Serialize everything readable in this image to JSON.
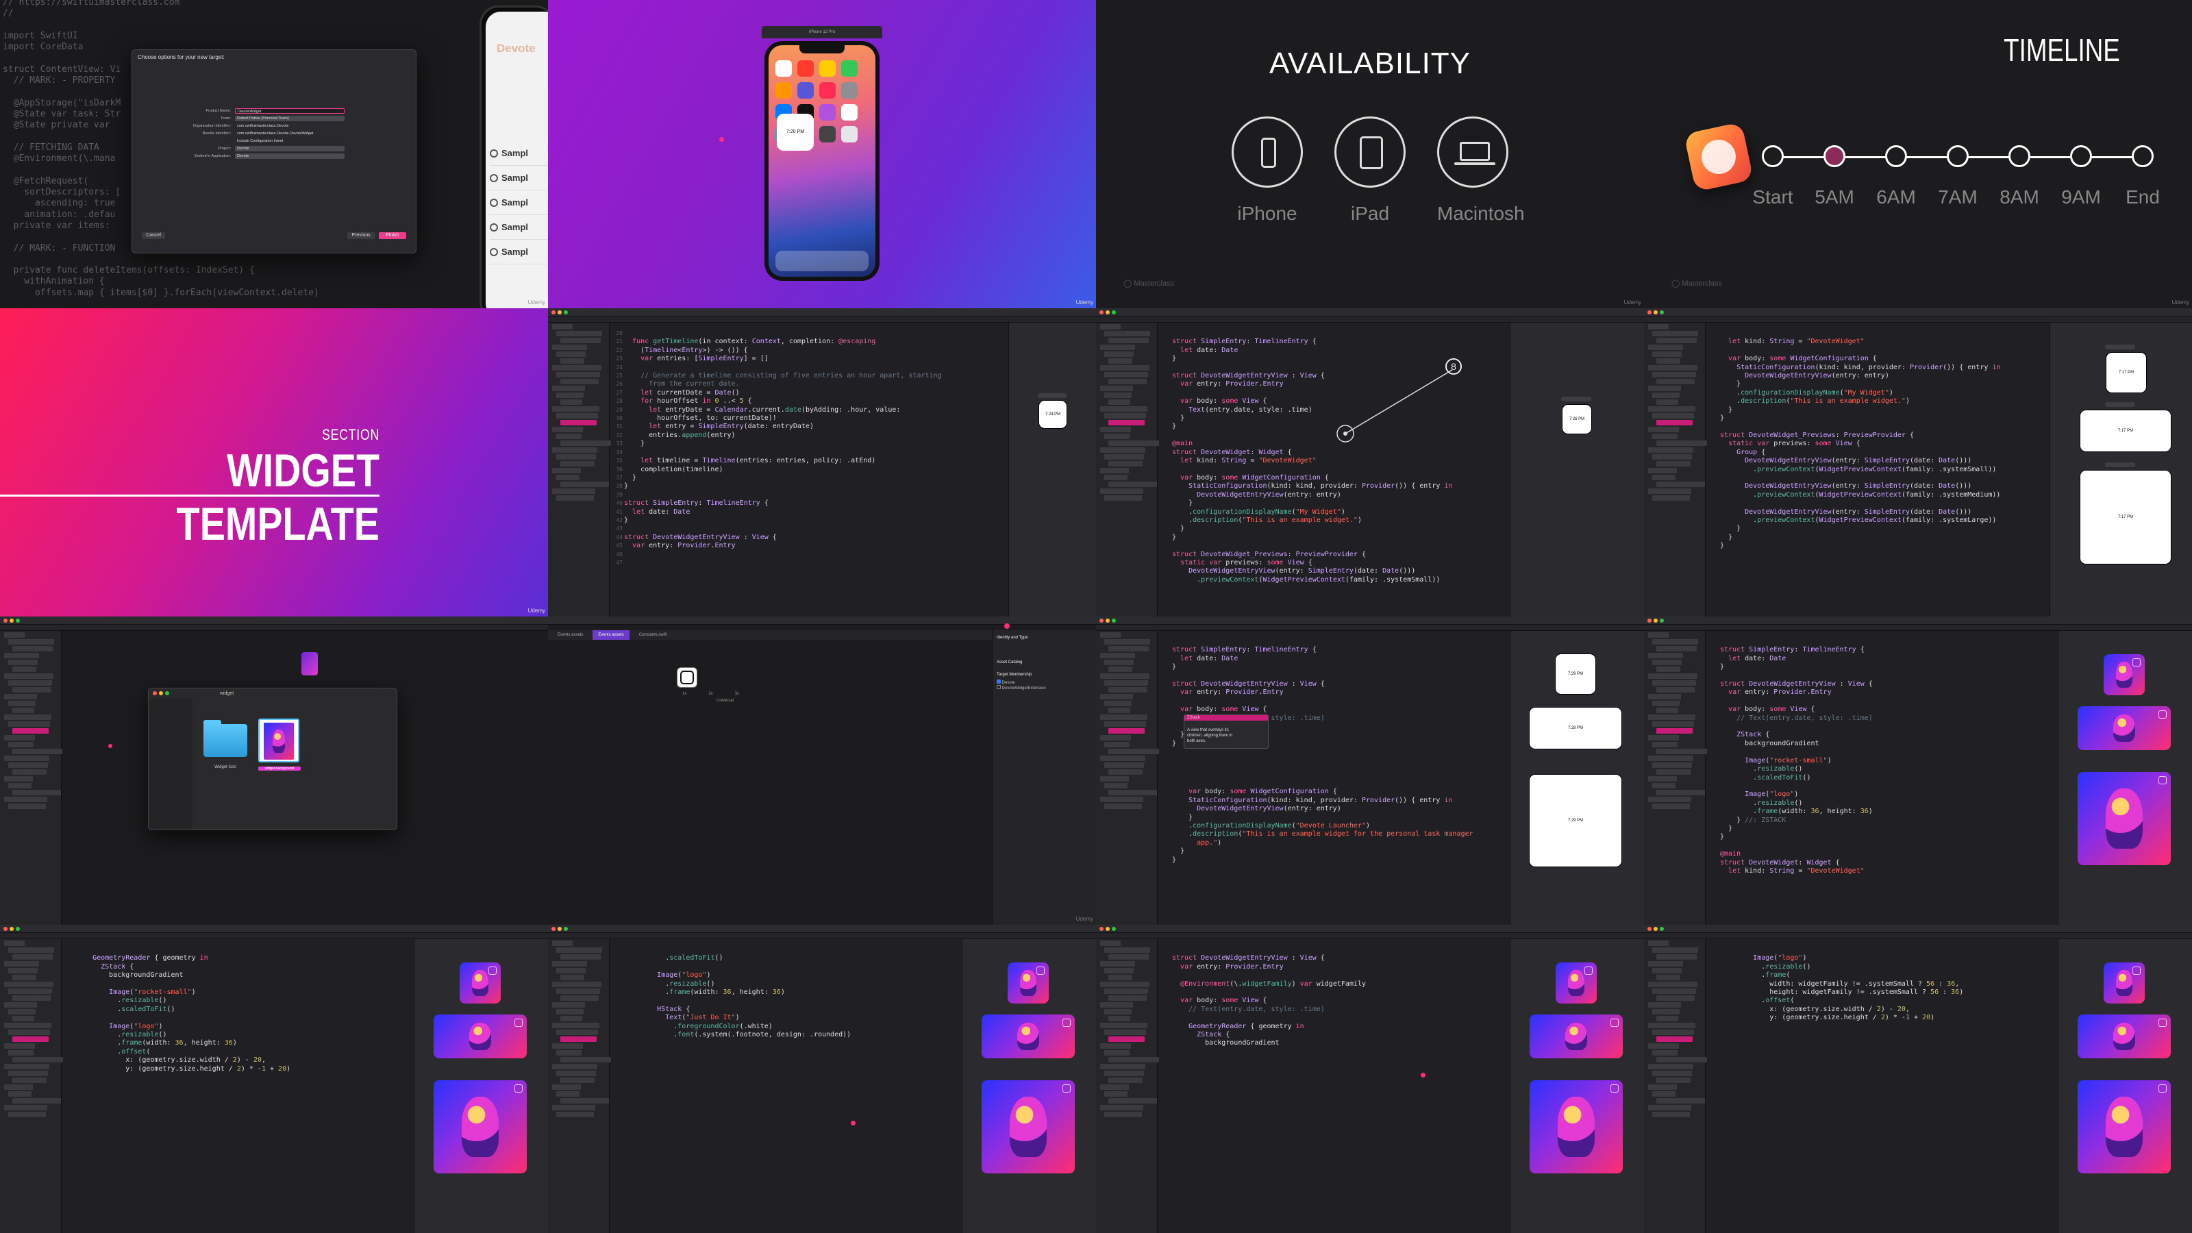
{
  "slide1": {
    "code_lines": [
      "// https://swiftuimasterclass.com",
      "//",
      "",
      "import SwiftUI",
      "import CoreData",
      "",
      "struct ContentView: Vi",
      "  // MARK: - PROPERTY",
      "",
      "  @AppStorage(\"isDarkM",
      "  @State var task: Str",
      "  @State private var",
      "",
      "  // FETCHING DATA",
      "  @Environment(\\.mana",
      "",
      "  @FetchRequest(",
      "    sortDescriptors: [",
      "      ascending: true",
      "    animation: .defau",
      "  private var items:",
      "",
      "  // MARK: - FUNCTION",
      "",
      "  private func deleteItems(offsets: IndexSet) {",
      "    withAnimation {",
      "      offsets.map { items[$0] }.forEach(viewContext.delete)"
    ],
    "dialog_title": "Choose options for your new target:",
    "fields": [
      {
        "label": "Product Name:",
        "value": "DevoteWidget"
      },
      {
        "label": "Team:",
        "value": "Robert Petras (Personal Team)"
      },
      {
        "label": "Organization Identifier:",
        "value": "com.swiftuimasterclass.Devote"
      },
      {
        "label": "Bundle Identifier:",
        "value": "com.swiftuimasterclass.Devote.DevoteWidget"
      },
      {
        "label": "",
        "value": "Include Configuration Intent"
      },
      {
        "label": "Project:",
        "value": "Devote"
      },
      {
        "label": "Embed in Application:",
        "value": "Devote"
      }
    ],
    "cancel": "Cancel",
    "previous": "Previous",
    "finish": "Finish",
    "app_title": "Devote",
    "list_items": [
      "Sampl",
      "Sampl",
      "Sampl",
      "Sampl",
      "Sampl"
    ],
    "watermark": "Udemy"
  },
  "slide2": {
    "phone_time": "7:20 PM",
    "notch_text": "iPhone 12 Pro",
    "watermark": "Udemy"
  },
  "slide3": {
    "title": "AVAILABILITY",
    "devices": [
      "iPhone",
      "iPad",
      "Macintosh"
    ],
    "brand": "Masterclass",
    "watermark": "Udemy"
  },
  "slide4": {
    "title": "TIMELINE",
    "stops": [
      "Start",
      "5AM",
      "6AM",
      "7AM",
      "8AM",
      "9AM",
      "End"
    ],
    "brand": "Masterclass",
    "watermark": "Udemy"
  },
  "slide5": {
    "section": "SECTION",
    "title": "WIDGET TEMPLATE",
    "watermark": "Udemy"
  },
  "slide6": {
    "gutter": "20\n21\n22\n23\n24\n25\n26\n27\n28\n29\n30\n31\n32\n33\n34\n35\n36\n37\n38\n39\n40\n41\n42\n43\n44\n45\n46\n47",
    "preview_time": "7:24 PM"
  },
  "slide7": {
    "preview_time": "7:26 PM",
    "badge": "8"
  },
  "slide8": {
    "preview_times": [
      "7:17 PM",
      "7:17 PM",
      "7:17 PM"
    ]
  },
  "slide9": {
    "folder_name": "Widget Icon",
    "file_name": "widget-background",
    "window_title": "widget"
  },
  "slide10": {
    "tabs": [
      "Events assets",
      "Events assets",
      "Constants.swift"
    ],
    "panel_title": "Identity and Type",
    "sections": [
      "Asset Catalog",
      "Target Membership"
    ],
    "members": [
      "Devote",
      "DevoteWidgetExtension"
    ],
    "universal": "Universal",
    "slot_labels": [
      "1x",
      "2x",
      "3x"
    ],
    "watermark": "Udemy"
  },
  "slide11": {
    "preview_times": [
      "7:29 PM",
      "7:29 PM",
      "7:29 PM"
    ],
    "tooltip": "A view that overlays its children, aligning them in both axes.",
    "highlight": "ZStack"
  }
}
